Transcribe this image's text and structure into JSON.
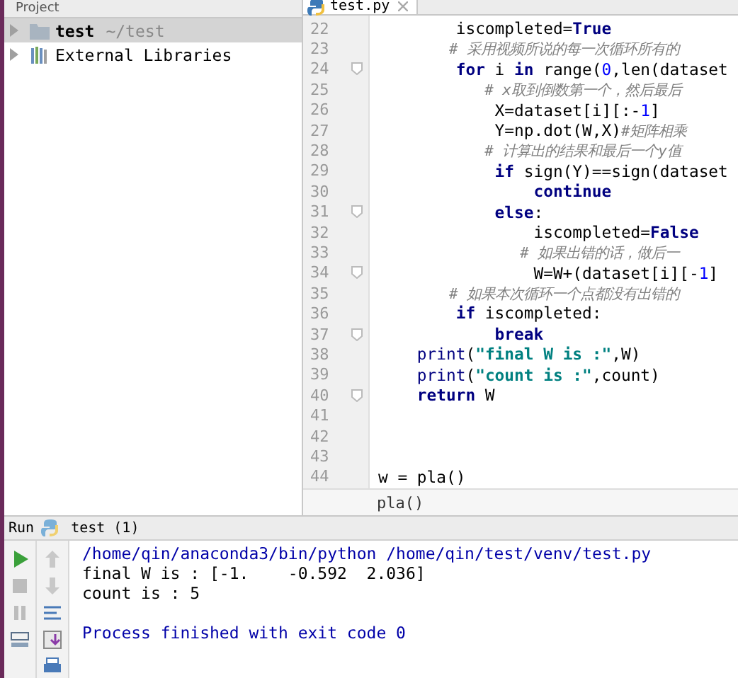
{
  "project_panel": {
    "title": "Project",
    "tree": [
      {
        "label": "test",
        "path": "~/test",
        "kind": "folder",
        "selected": true
      },
      {
        "label": "External Libraries",
        "kind": "library",
        "selected": false
      }
    ]
  },
  "editor": {
    "tab": {
      "label": "test.py",
      "selected": true
    },
    "lines": [
      {
        "number": "22",
        "fold": false,
        "tokens": [
          {
            "text": "        iscompleted=",
            "kind": "plain"
          },
          {
            "text": "True",
            "kind": "keyword"
          }
        ]
      },
      {
        "number": "23",
        "fold": false,
        "tokens": [
          {
            "text": "        # 采用视频所说的每一次循环所有的",
            "kind": "comment"
          }
        ]
      },
      {
        "number": "24",
        "fold": true,
        "tokens": [
          {
            "text": "        for",
            "kind": "keyword"
          },
          {
            "text": " i ",
            "kind": "plain"
          },
          {
            "text": "in",
            "kind": "keyword"
          },
          {
            "text": " range(",
            "kind": "plain"
          },
          {
            "text": "0",
            "kind": "number"
          },
          {
            "text": ",len(dataset",
            "kind": "plain"
          }
        ]
      },
      {
        "number": "25",
        "fold": false,
        "tokens": [
          {
            "text": "            # x取到倒数第一个，然后最后",
            "kind": "comment"
          }
        ]
      },
      {
        "number": "26",
        "fold": false,
        "tokens": [
          {
            "text": "            X=dataset[i][:-",
            "kind": "plain"
          },
          {
            "text": "1",
            "kind": "number"
          },
          {
            "text": "]",
            "kind": "plain"
          }
        ]
      },
      {
        "number": "27",
        "fold": false,
        "tokens": [
          {
            "text": "            Y=np.dot(W,X)",
            "kind": "plain"
          },
          {
            "text": "#矩阵相乘",
            "kind": "comment"
          }
        ]
      },
      {
        "number": "28",
        "fold": false,
        "tokens": [
          {
            "text": "            # 计算出的结果和最后一个y值",
            "kind": "comment"
          }
        ]
      },
      {
        "number": "29",
        "fold": false,
        "tokens": [
          {
            "text": "            if",
            "kind": "keyword"
          },
          {
            "text": " sign(Y)==sign(dataset",
            "kind": "plain"
          }
        ]
      },
      {
        "number": "30",
        "fold": false,
        "tokens": [
          {
            "text": "                continue",
            "kind": "keyword"
          }
        ]
      },
      {
        "number": "31",
        "fold": true,
        "tokens": [
          {
            "text": "            else",
            "kind": "keyword"
          },
          {
            "text": ":",
            "kind": "plain"
          }
        ]
      },
      {
        "number": "32",
        "fold": false,
        "tokens": [
          {
            "text": "                iscompleted=",
            "kind": "plain"
          },
          {
            "text": "False",
            "kind": "keyword"
          }
        ]
      },
      {
        "number": "33",
        "fold": false,
        "tokens": [
          {
            "text": "                # 如果出错的话，做后一",
            "kind": "comment"
          }
        ]
      },
      {
        "number": "34",
        "fold": true,
        "tokens": [
          {
            "text": "                W=W+(dataset[i][-",
            "kind": "plain"
          },
          {
            "text": "1",
            "kind": "number"
          },
          {
            "text": "]",
            "kind": "plain"
          }
        ]
      },
      {
        "number": "35",
        "fold": false,
        "tokens": [
          {
            "text": "        # 如果本次循环一个点都没有出错的",
            "kind": "comment"
          }
        ]
      },
      {
        "number": "36",
        "fold": false,
        "tokens": [
          {
            "text": "        if",
            "kind": "keyword"
          },
          {
            "text": " iscompleted:",
            "kind": "plain"
          }
        ]
      },
      {
        "number": "37",
        "fold": true,
        "tokens": [
          {
            "text": "            break",
            "kind": "keyword"
          }
        ]
      },
      {
        "number": "38",
        "fold": false,
        "tokens": [
          {
            "text": "    print",
            "kind": "builtin"
          },
          {
            "text": "(",
            "kind": "plain"
          },
          {
            "text": "\"final W is :\"",
            "kind": "string"
          },
          {
            "text": ",W)",
            "kind": "plain"
          }
        ]
      },
      {
        "number": "39",
        "fold": false,
        "tokens": [
          {
            "text": "    print",
            "kind": "builtin"
          },
          {
            "text": "(",
            "kind": "plain"
          },
          {
            "text": "\"count is :\"",
            "kind": "string"
          },
          {
            "text": ",count)",
            "kind": "plain"
          }
        ]
      },
      {
        "number": "40",
        "fold": true,
        "tokens": [
          {
            "text": "    return",
            "kind": "keyword"
          },
          {
            "text": " W",
            "kind": "plain"
          }
        ]
      },
      {
        "number": "41",
        "fold": false
      },
      {
        "number": "42",
        "fold": false
      },
      {
        "number": "43",
        "fold": false
      },
      {
        "number": "44",
        "fold": false,
        "tokens": [
          {
            "text": "w = pla()",
            "kind": "plain"
          }
        ]
      }
    ],
    "breadcrumb": "pla()"
  },
  "run_panel": {
    "title": "Run",
    "config": "test (1)",
    "output": [
      {
        "text": "/home/qin/anaconda3/bin/python /home/qin/test/venv/test.py",
        "kind": "system"
      },
      {
        "text": "final W is : [-1.    -0.592  2.036]",
        "kind": "stdout"
      },
      {
        "text": "count is : 5",
        "kind": "stdout"
      },
      {
        "kind": "blank"
      },
      {
        "text": "Process finished with exit code 0",
        "kind": "system"
      }
    ]
  }
}
